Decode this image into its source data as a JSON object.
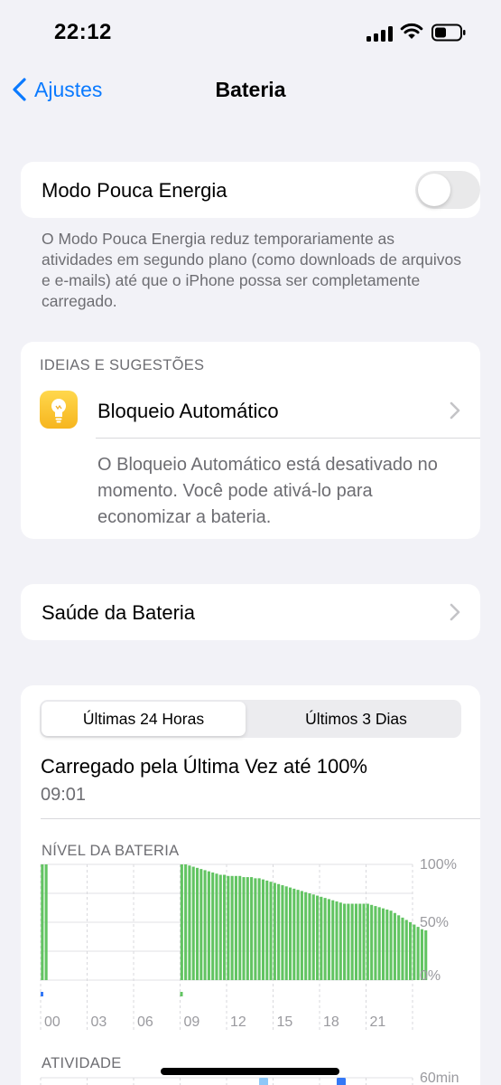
{
  "status": {
    "time": "22:12"
  },
  "nav": {
    "back_label": "Ajustes",
    "title": "Bateria"
  },
  "low_power": {
    "label": "Modo Pouca Energia",
    "enabled": false,
    "footnote": "O Modo Pouca Energia reduz temporariamente as atividades em segundo plano (como downloads de arquivos e e-mails) até que o iPhone possa ser completamente carregado."
  },
  "suggestions": {
    "header": "IDEIAS E SUGESTÕES",
    "item_label": "Bloqueio Automático",
    "item_description": "O Bloqueio Automático está desativado no momento. Você pode ativá-lo para economizar a bateria."
  },
  "health": {
    "label": "Saúde da Bateria"
  },
  "usage": {
    "tabs": [
      "Últimas 24 Horas",
      "Últimos 3 Dias"
    ],
    "active_tab": 0,
    "charged_title": "Carregado pela Última Vez até 100%",
    "charged_time": "09:01"
  },
  "colors": {
    "accent": "#0a7aff",
    "battery_green": "#62c462",
    "activity_blue": "#3478f6",
    "activity_light_blue": "#8ec8f8"
  },
  "chart_data": [
    {
      "type": "bar",
      "title": "NÍVEL DA BATERIA",
      "x_tick_labels": [
        "00",
        "03",
        "06",
        "09",
        "12",
        "15",
        "18",
        "21"
      ],
      "y_tick_labels": [
        "100%",
        "50%",
        "0%"
      ],
      "ylim": [
        0,
        100
      ],
      "grid": true,
      "series": [
        {
          "values": [
            100,
            100,
            null,
            null,
            null,
            null,
            null,
            null,
            null,
            null,
            null,
            null,
            null,
            null,
            null,
            null,
            null,
            null,
            null,
            null,
            null,
            null,
            null,
            null,
            null,
            null,
            null,
            null,
            null,
            null,
            null,
            null,
            null,
            null,
            null,
            null,
            100,
            100,
            99,
            98,
            97,
            96,
            95,
            94,
            93,
            92,
            91,
            91,
            90,
            90,
            90,
            90,
            89,
            89,
            89,
            88,
            88,
            87,
            86,
            85,
            84,
            83,
            82,
            81,
            80,
            79,
            78,
            77,
            76,
            75,
            74,
            73,
            72,
            71,
            70,
            69,
            68,
            67,
            66,
            66,
            66,
            66,
            66,
            66,
            66,
            65,
            64,
            63,
            62,
            61,
            60,
            58,
            56,
            54,
            52,
            50,
            48,
            46,
            44,
            43
          ]
        }
      ]
    },
    {
      "type": "bar",
      "title": "ATIVIDADE",
      "y_tick_labels": [
        "60min"
      ]
    }
  ]
}
